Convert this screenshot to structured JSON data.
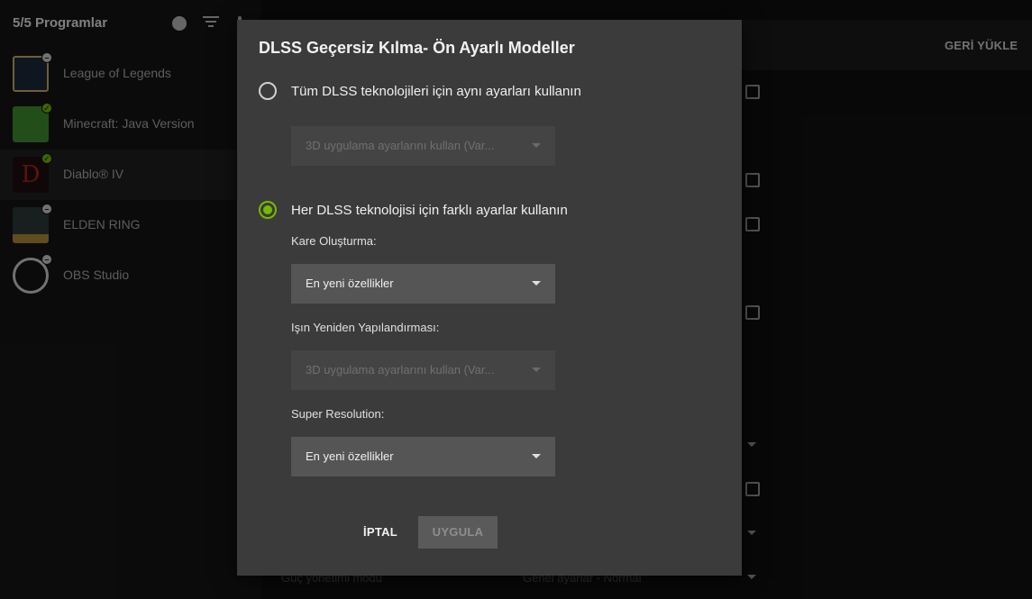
{
  "sidebar": {
    "title": "5/5 Programlar",
    "programs": [
      {
        "name": "League of Legends",
        "badge": "minus",
        "color": "#c8aa6e"
      },
      {
        "name": "Minecraft: Java Version",
        "badge": "check",
        "color": "#3f8f2f"
      },
      {
        "name": "Diablo® IV",
        "badge": "check",
        "color": "#8a1a1a"
      },
      {
        "name": "ELDEN RING",
        "badge": "minus",
        "color": "#b08a3a"
      },
      {
        "name": "OBS Studio",
        "badge": "minus",
        "color": "#2a2a2a"
      }
    ]
  },
  "main": {
    "restore_label": "GERİ YÜKLE",
    "bg_row_left": "Güç yönetimi modu",
    "bg_row_right": "Genel ayarlar - Normal"
  },
  "modal": {
    "title": "DLSS Geçersiz Kılma- Ön Ayarlı Modeller",
    "option_same": "Tüm DLSS teknolojileri için aynı ayarları kullanın",
    "option_same_select": "3D uygulama ayarlarını kullan (Var...",
    "option_different": "Her DLSS teknolojisi için farklı ayarlar kullanın",
    "frame_gen_label": "Kare Oluşturma:",
    "frame_gen_value": "En yeni özellikler",
    "ray_label": "Işın Yeniden Yapılandırması:",
    "ray_value": "3D uygulama ayarlarını kullan (Var...",
    "sr_label": "Super Resolution:",
    "sr_value": "En yeni özellikler",
    "cancel_label": "İPTAL",
    "apply_label": "UYGULA"
  },
  "colors": {
    "accent": "#76b900",
    "modal_bg": "#3b3b3b"
  }
}
